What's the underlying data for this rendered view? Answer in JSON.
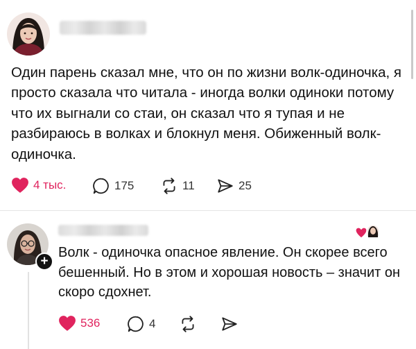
{
  "post": {
    "author_avatar": "woman-portrait",
    "text": "Один парень сказал мне, что он по жизни волк-одиночка, я просто сказала что читала - иногда волки одиноки потому что их выгнали со стаи, он сказал что я тупая и не разбираюсь в волках и блокнул меня. Обиженный волк-одиночка.",
    "likes": "4 тыс.",
    "comments": "175",
    "reposts": "11",
    "shares": "25"
  },
  "reply": {
    "author_avatar": "woman-with-glasses-portrait",
    "text": "Волк - одиночка опасное явление. Он скорее всего бешенный. Но в этом и хорошая новость – значит он скоро сдохнет.",
    "likes": "536",
    "comments": "4",
    "follow_glyph": "+"
  },
  "colors": {
    "like": "#e0245e",
    "text": "#111111",
    "muted": "#333333"
  },
  "icons": [
    "heart-icon",
    "comment-icon",
    "repost-icon",
    "share-icon",
    "follow-plus-icon",
    "liked-by-author-icon"
  ]
}
